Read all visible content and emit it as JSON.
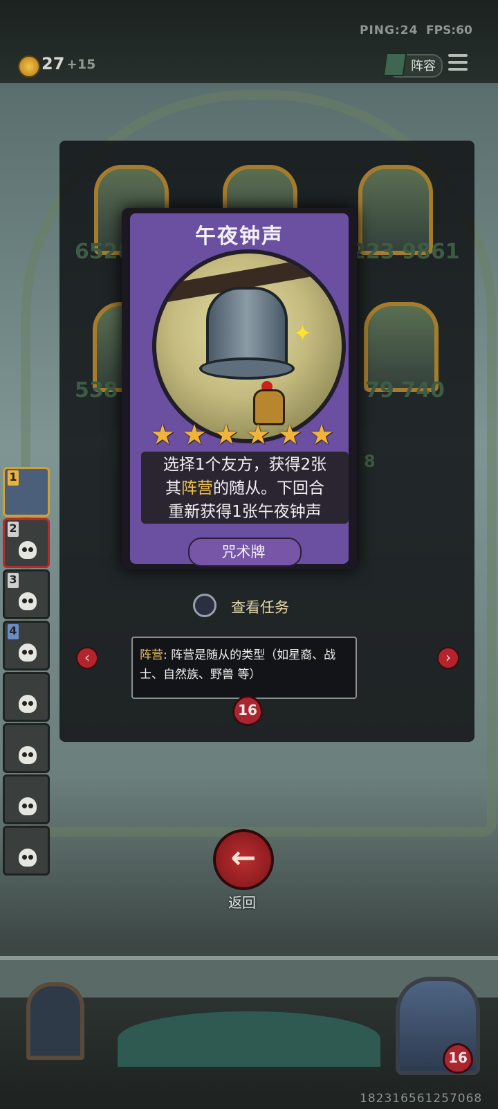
{
  "hud": {
    "ping": "PING:24",
    "fps": "FPS:60",
    "gold": "27",
    "gold_income": "+15",
    "lineup_label": "阵容"
  },
  "slots": [
    {
      "num": "1"
    },
    {
      "num": "2"
    },
    {
      "num": "3"
    },
    {
      "num": "4"
    },
    {
      "num": ""
    },
    {
      "num": ""
    },
    {
      "num": ""
    },
    {
      "num": ""
    }
  ],
  "board_numbers": {
    "row1_left": "6528",
    "row1_right": "223 9861",
    "row2_left": "538",
    "row2_right": "79 740",
    "badge_round": "8"
  },
  "card": {
    "title": "午夜钟声",
    "stars": [
      "★",
      "★",
      "★",
      "★",
      "★",
      "★"
    ],
    "desc_line1": "选择1个友方，获得2张",
    "desc_line2_pre": "其",
    "desc_line2_hl": "阵营",
    "desc_line2_post": "的随从。下回合",
    "desc_line3": "重新获得1张午夜钟声",
    "type": "咒术牌"
  },
  "task": {
    "label": "查看任务"
  },
  "tooltip": {
    "key": "阵营",
    "text": ": 阵营是随从的类型（如星裔、战士、自然族、野兽 等）"
  },
  "health_badges": {
    "center": "16",
    "bottom_right": "16"
  },
  "back": {
    "label": "返回",
    "glyph": "←"
  },
  "nav_arrows": {
    "left": "‹",
    "right": "›"
  },
  "serial": "1823165612570​68"
}
